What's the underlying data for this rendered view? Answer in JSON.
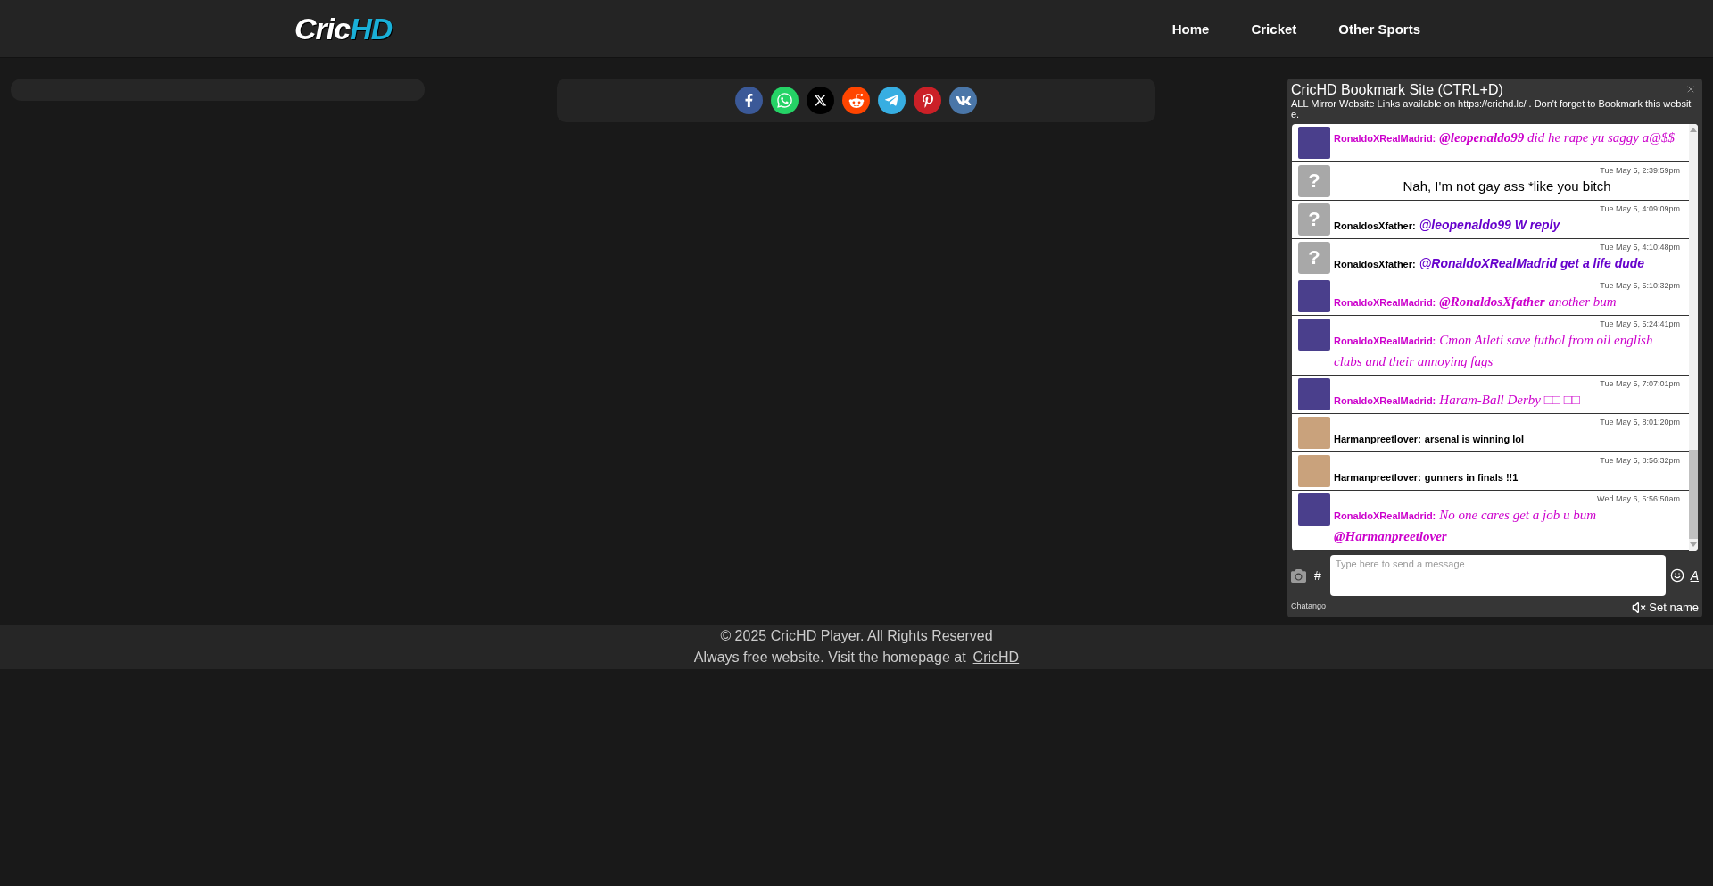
{
  "header": {
    "logo": {
      "part_1": "Cric",
      "part_2": "HD"
    },
    "nav": [
      "Home",
      "Cricket",
      "Other Sports"
    ]
  },
  "share_buttons": [
    {
      "kind": "facebook"
    },
    {
      "kind": "whatsapp"
    },
    {
      "kind": "x"
    },
    {
      "kind": "reddit"
    },
    {
      "kind": "telegram"
    },
    {
      "kind": "pinterest"
    },
    {
      "kind": "vk"
    }
  ],
  "chat": {
    "title": "CricHD Bookmark Site (CTRL+D)",
    "notice": "ALL Mirror Website Links available on https://crichd.lc/ . Don't forget to Bookmark this website.",
    "messages": [
      {
        "kind": "serif",
        "avatar": {
          "kind": "photo",
          "color": "#4a3f8c"
        },
        "name": {
          "label": "RonaldoXRealMadrid:",
          "color": "#cc00cc"
        },
        "message": {
          "text": "**@leopenaldo99** did he rape yu saggy a@$$",
          "color": "#cc00cc"
        }
      },
      {
        "kind": "centered",
        "time": "Tue May 5, 2:39:59pm",
        "avatar": {
          "kind": "unknown",
          "glyph": "?"
        },
        "message": {
          "text": "Nah, I'm not gay ass *like you bitch",
          "color": "#000000"
        }
      },
      {
        "kind": "emphatic",
        "time": "Tue May 5, 4:09:09pm",
        "avatar": {
          "kind": "unknown",
          "glyph": "?"
        },
        "name": {
          "label": "RonaldosXfather:",
          "color": "#000000"
        },
        "message": {
          "text": "@leopenaldo99 W reply",
          "color": "#6600cc"
        }
      },
      {
        "kind": "emphatic",
        "time": "Tue May 5, 4:10:48pm",
        "avatar": {
          "kind": "unknown",
          "glyph": "?"
        },
        "name": {
          "label": "RonaldosXfather:",
          "color": "#000000"
        },
        "message": {
          "text": "@RonaldoXRealMadrid get a life dude",
          "color": "#6600cc"
        }
      },
      {
        "kind": "serif",
        "time": "Tue May 5, 5:10:32pm",
        "avatar": {
          "kind": "photo",
          "color": "#4a3f8c"
        },
        "name": {
          "label": "RonaldoXRealMadrid:",
          "color": "#cc00cc"
        },
        "message": {
          "text": "**@RonaldosXfather** another bum",
          "color": "#cc00cc"
        }
      },
      {
        "kind": "serif",
        "time": "Tue May 5, 5:24:41pm",
        "avatar": {
          "kind": "photo",
          "color": "#4a3f8c"
        },
        "name": {
          "label": "RonaldoXRealMadrid:",
          "color": "#cc00cc"
        },
        "message": {
          "text": "Cmon Atleti save futbol from oil english clubs and their annoying fags",
          "color": "#cc00cc"
        }
      },
      {
        "kind": "serif",
        "time": "Tue May 5, 7:07:01pm",
        "avatar": {
          "kind": "photo",
          "color": "#4a3f8c"
        },
        "name": {
          "label": "RonaldoXRealMadrid:",
          "color": "#cc00cc"
        },
        "message": {
          "text": "Haram-Ball Derby □□ □□",
          "color": "#cc00cc"
        }
      },
      {
        "kind": "bold",
        "time": "Tue May 5, 8:01:20pm",
        "avatar": {
          "kind": "photo",
          "color": "#c9a27c"
        },
        "name": {
          "label": "Harmanpreetlover:",
          "color": "#000000"
        },
        "message": {
          "text": "arsenal is winning lol",
          "color": "#000000"
        }
      },
      {
        "kind": "bold",
        "time": "Tue May 5, 8:56:32pm",
        "avatar": {
          "kind": "photo",
          "color": "#c9a27c"
        },
        "name": {
          "label": "Harmanpreetlover:",
          "color": "#000000"
        },
        "message": {
          "text": "gunners in finals !!1",
          "color": "#000000"
        }
      },
      {
        "kind": "serif",
        "time": "Wed May 6, 5:56:50am",
        "avatar": {
          "kind": "photo",
          "color": "#4a3f8c"
        },
        "name": {
          "label": "RonaldoXRealMadrid:",
          "color": "#cc00cc"
        },
        "message": {
          "text": "No one cares get a job u bum **@Harmanpreetlover**",
          "color": "#cc00cc"
        }
      }
    ],
    "input": {
      "placeholder": "Type here to send a message"
    },
    "hash_button": "#",
    "format_button": "A",
    "brand": "Chatango",
    "set_name": "Set name"
  },
  "footer": {
    "copyright": "© 2025 CricHD Player. All Rights Reserved",
    "homepage_text": "Always free website. Visit the homepage at",
    "homepage_link": "CricHD"
  }
}
